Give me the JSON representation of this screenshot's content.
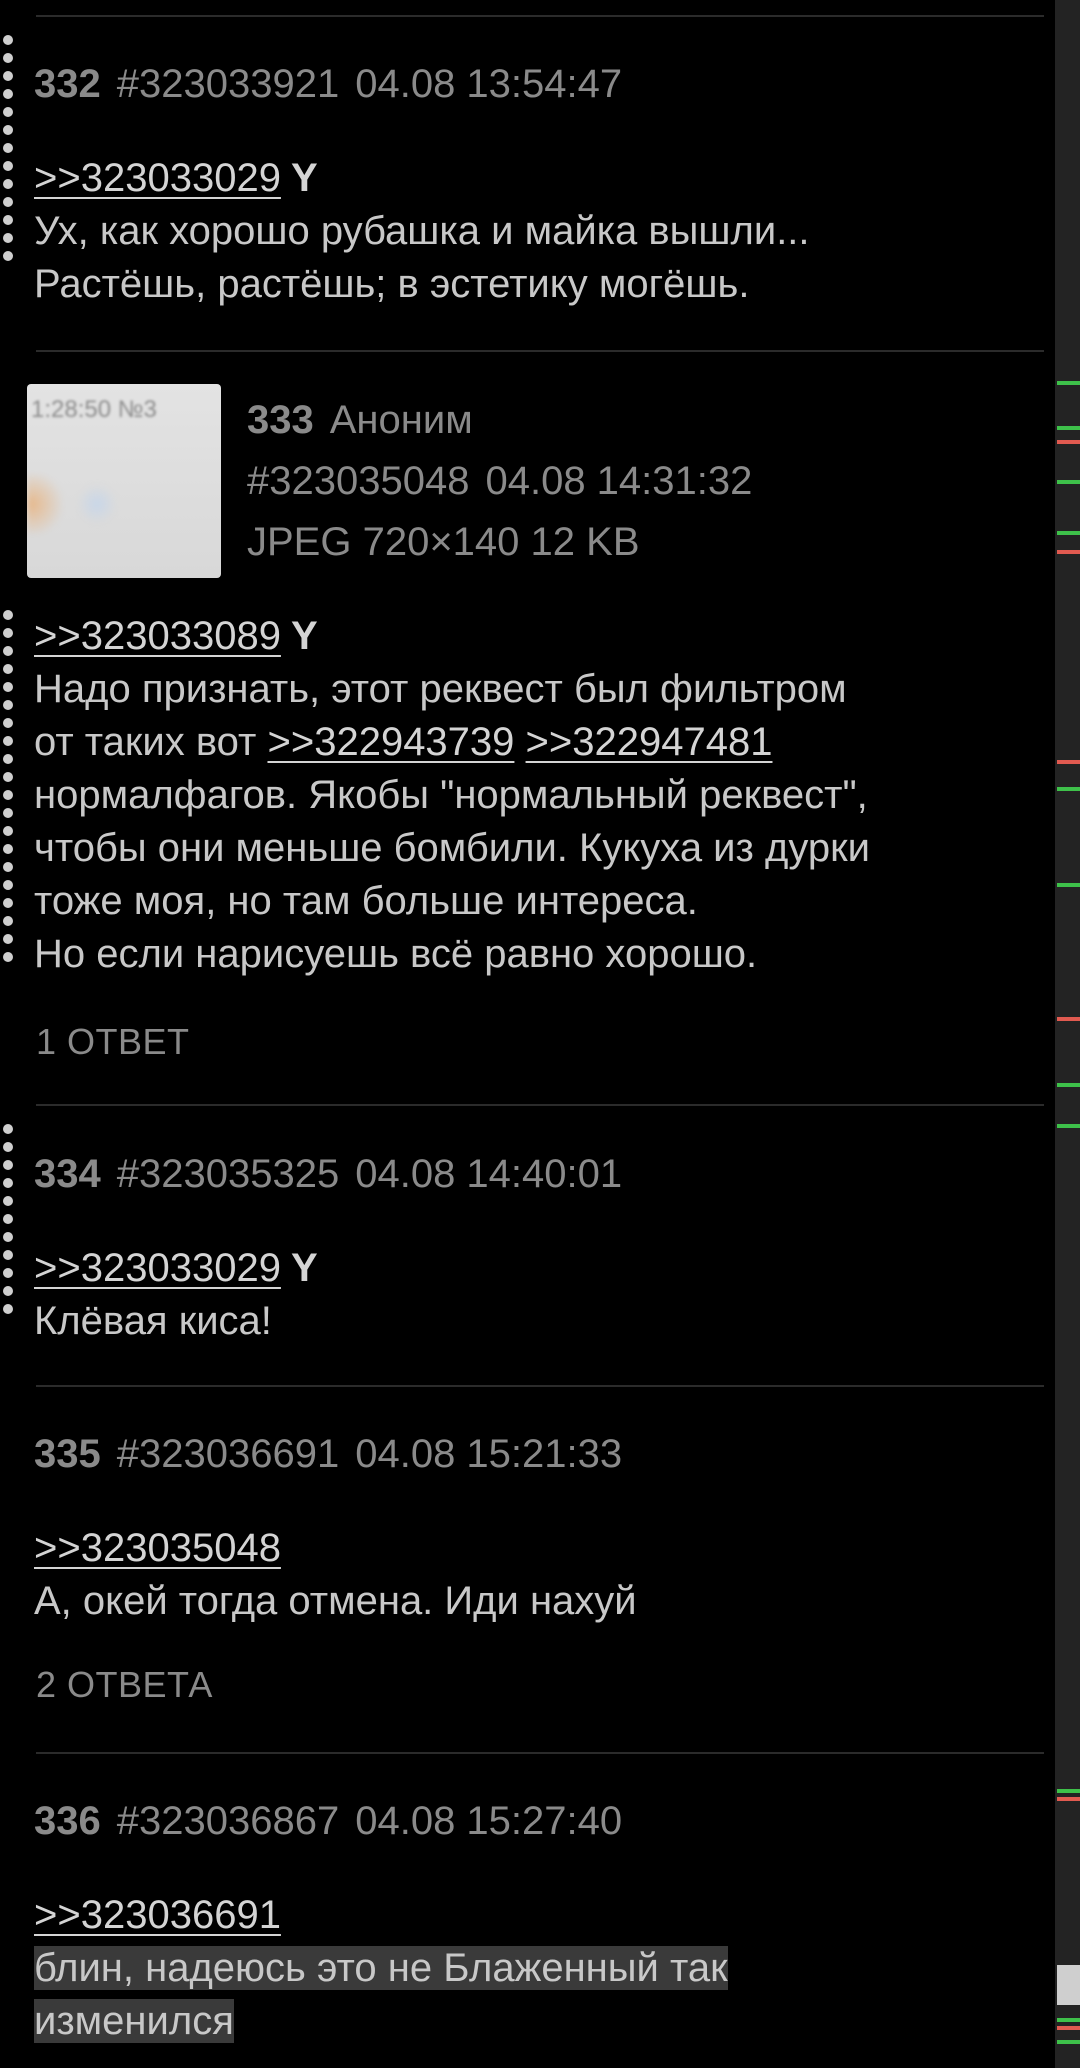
{
  "colors": {
    "background": "#000000",
    "text": "#c8c8c8",
    "meta": "#8a8a8a",
    "accent_green": "#3ec14a",
    "accent_red": "#e15a50"
  },
  "posts": [
    {
      "num": "332",
      "id": "#323033921",
      "datetime": "04.08 13:54:47",
      "ref": ">>323033029",
      "you": "Y",
      "lines": [
        "Ух, как хорошо рубашка и майка вышли...",
        "Растёшь, растёшь; в эстетику могёшь."
      ]
    },
    {
      "num": "333",
      "name": "Аноним",
      "id": "#323035048",
      "datetime": "04.08 14:31:32",
      "file_info": "JPEG 720×140 12 KB",
      "thumb_text": "1:28:50 №3",
      "ref": ">>323033089",
      "you": "Y",
      "line1": "Надо признать, этот реквест был фильтром",
      "line2_prefix": "от таких вот ",
      "ref2": ">>322943739",
      "ref3": ">>322947481",
      "line3": " нормалфагов. Якобы \"нормальный реквест\",",
      "line4": "чтобы они меньше бомбили. Кукуха из дурки",
      "line5": "тоже моя, но там больше интереса.",
      "line6": "Но если нарисуешь всё равно хорошо.",
      "replies": "1 ОТВЕТ"
    },
    {
      "num": "334",
      "id": "#323035325",
      "datetime": "04.08 14:40:01",
      "ref": ">>323033029",
      "you": "Y",
      "lines": [
        "Клёвая киса!"
      ]
    },
    {
      "num": "335",
      "id": "#323036691",
      "datetime": "04.08 15:21:33",
      "ref": ">>323035048",
      "lines": [
        "А, окей тогда отмена. Иди нахуй"
      ],
      "replies": "2 ОТВЕТА"
    },
    {
      "num": "336",
      "id": "#323036867",
      "datetime": "04.08 15:27:40",
      "ref": ">>323036691",
      "lines": [
        "блин, надеюсь это не Блаженный так",
        "изменился"
      ]
    }
  ]
}
